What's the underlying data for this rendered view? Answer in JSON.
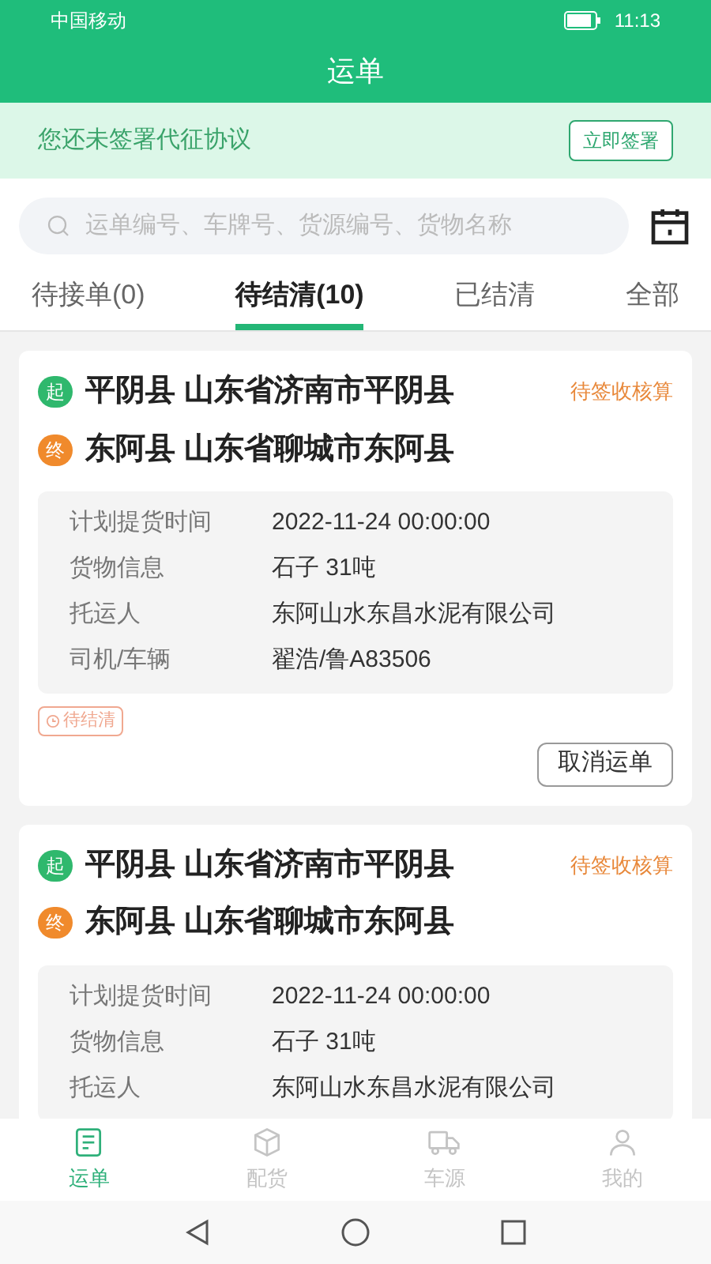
{
  "status_bar": {
    "carrier": "中国移动",
    "time": "11:13"
  },
  "title": "运单",
  "banner": {
    "text": "您还未签署代征协议",
    "button": "立即签署"
  },
  "search": {
    "placeholder": "运单编号、车牌号、货源编号、货物名称"
  },
  "tabs": [
    {
      "label": "待接单(0)",
      "selected": false
    },
    {
      "label": "待结清(10)",
      "selected": true
    },
    {
      "label": "已结清",
      "selected": false
    },
    {
      "label": "全部",
      "selected": false
    }
  ],
  "orders": [
    {
      "start_tag": "起",
      "start": "平阴县 山东省济南市平阴县",
      "end_tag": "终",
      "end": "东阿县 山东省聊城市东阿县",
      "status": "待签收核算",
      "rows": [
        {
          "label": "计划提货时间",
          "value": "2022-11-24 00:00:00"
        },
        {
          "label": "货物信息",
          "value": "石子 31吨"
        },
        {
          "label": "托运人",
          "value": "东阿山水东昌水泥有限公司"
        },
        {
          "label": "司机/车辆",
          "value": "翟浩/鲁A83506"
        }
      ],
      "tag": "待结清",
      "button": "取消运单"
    },
    {
      "start_tag": "起",
      "start": "平阴县 山东省济南市平阴县",
      "end_tag": "终",
      "end": "东阿县 山东省聊城市东阿县",
      "status": "待签收核算",
      "rows": [
        {
          "label": "计划提货时间",
          "value": "2022-11-24 00:00:00"
        },
        {
          "label": "货物信息",
          "value": "石子 31吨"
        },
        {
          "label": "托运人",
          "value": "东阿山水东昌水泥有限公司"
        }
      ]
    }
  ],
  "nav": [
    {
      "kind": "waybill",
      "label": "运单",
      "selected": true
    },
    {
      "kind": "box",
      "label": "配货",
      "selected": false
    },
    {
      "kind": "truck",
      "label": "车源",
      "selected": false
    },
    {
      "kind": "user",
      "label": "我的",
      "selected": false
    }
  ]
}
